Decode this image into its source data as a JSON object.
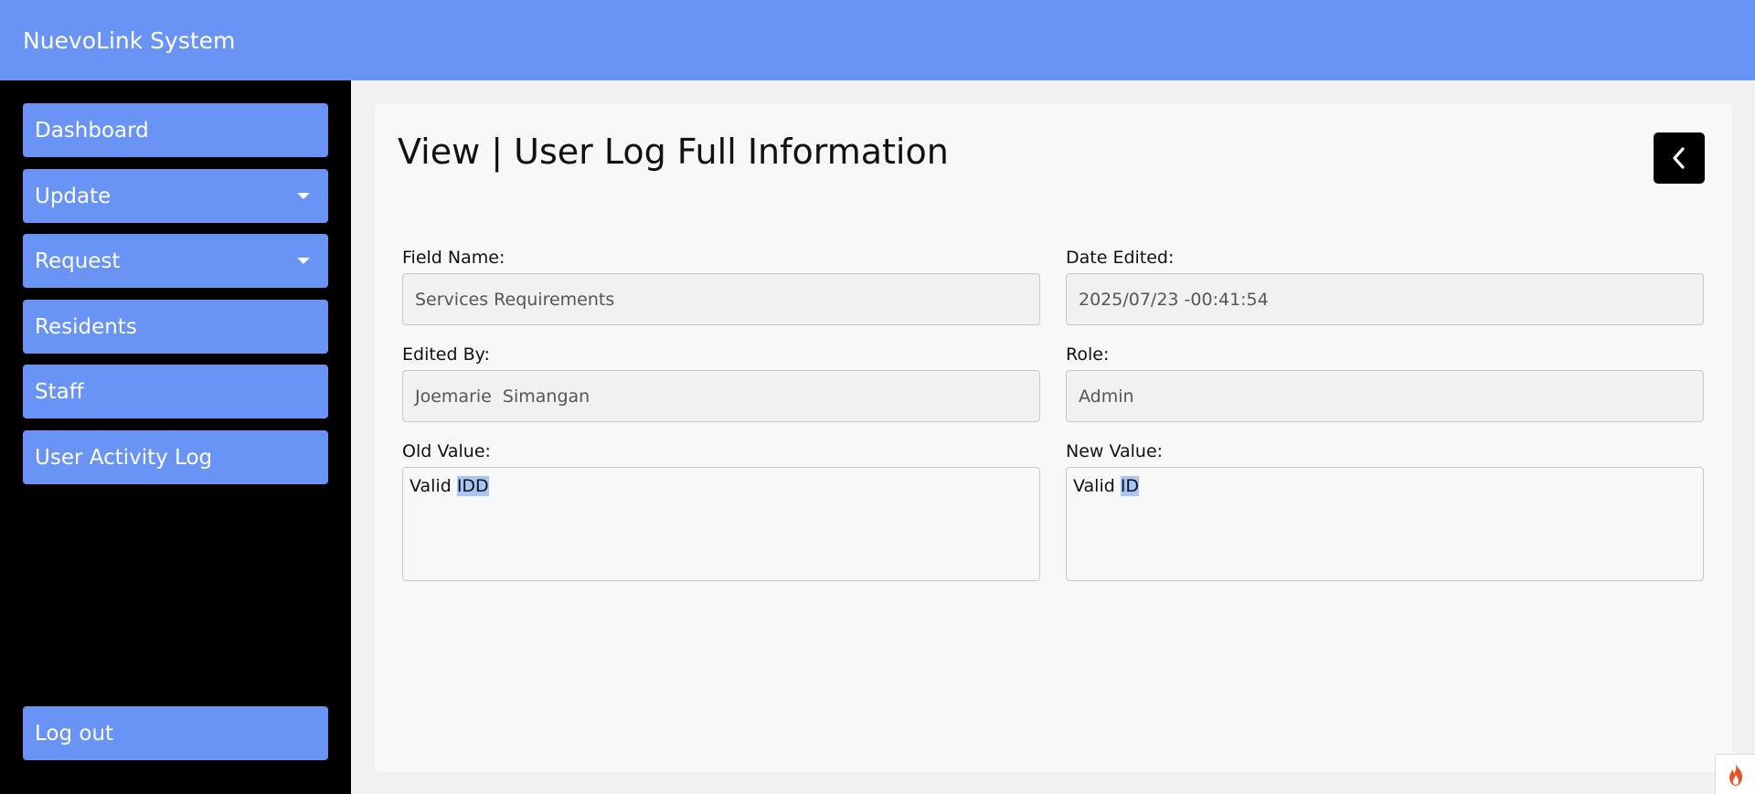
{
  "app": {
    "title": "NuevoLink System"
  },
  "sidebar": {
    "items": [
      {
        "label": "Dashboard",
        "has_dropdown": false
      },
      {
        "label": "Update",
        "has_dropdown": true
      },
      {
        "label": "Request",
        "has_dropdown": true
      },
      {
        "label": "Residents",
        "has_dropdown": false
      },
      {
        "label": "Staff",
        "has_dropdown": false
      },
      {
        "label": "User Activity Log",
        "has_dropdown": false
      }
    ],
    "logout_label": "Log out"
  },
  "main": {
    "title": "View | User Log Full Information",
    "back_icon": "chevron-left-icon",
    "fields": {
      "field_name": {
        "label": "Field Name:",
        "value": "Services Requirements"
      },
      "date_edited": {
        "label": "Date Edited:",
        "value": "2025/07/23 -00:41:54"
      },
      "edited_by": {
        "label": "Edited By:",
        "value": "Joemarie  Simangan"
      },
      "role": {
        "label": "Role:",
        "value": "Admin"
      },
      "old_value": {
        "label": "Old Value:",
        "value_plain": "Valid ",
        "value_selected": "IDD"
      },
      "new_value": {
        "label": "New Value:",
        "value_plain": "Valid ",
        "value_selected": "ID"
      }
    }
  },
  "colors": {
    "accent": "#6994f6",
    "sidebar_bg": "#000000",
    "selection": "#a9c5f5"
  },
  "badge_icon": "flame-icon"
}
